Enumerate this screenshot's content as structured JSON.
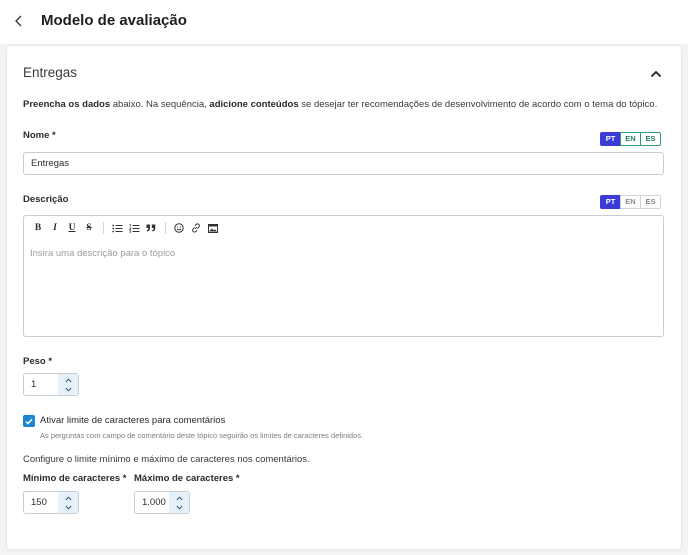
{
  "header": {
    "title": "Modelo de avaliação"
  },
  "section": {
    "title": "Entregas",
    "intro": {
      "bold1": "Preencha os dados",
      "text1": " abaixo. Na sequência, ",
      "bold2": "adicione conteúdos",
      "text2": " se desejar ter recomendações de desenvolvimento de acordo com o tema do tópico."
    }
  },
  "nome": {
    "label": "Nome *",
    "value": "Entregas",
    "languages": [
      "PT",
      "EN",
      "ES"
    ],
    "active_language": "PT"
  },
  "descricao": {
    "label": "Descrição",
    "placeholder": "Insira uma descrição para o tópico",
    "languages": [
      "PT",
      "EN",
      "ES"
    ],
    "active_language": "PT",
    "toolbar": {
      "bold": "B",
      "italic": "I",
      "underline": "U",
      "strikethrough": "S"
    }
  },
  "peso": {
    "label": "Peso *",
    "value": "1"
  },
  "limite": {
    "checked": true,
    "label": "Ativar limite de caracteres para comentários",
    "help": "As perguntas com campo de comentário deste tópico seguirão os limites de caracteres definidos."
  },
  "configure_text": "Configure o limite mínimo e máximo de caracteres nos comentários.",
  "minimo": {
    "label": "Mínimo de caracteres *",
    "value": "150"
  },
  "maximo": {
    "label": "Máximo de caracteres *",
    "value": "1.000"
  },
  "colors": {
    "primary": "#3b3bd6",
    "checkbox": "#1a86d0",
    "lang_border_green": "#2e9b74",
    "stepper_bg": "#e6f2fb"
  }
}
